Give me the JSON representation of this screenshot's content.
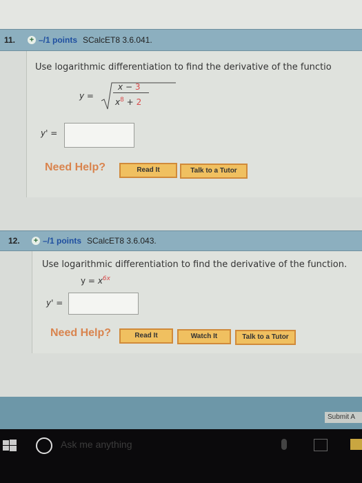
{
  "questions": [
    {
      "number": "11.",
      "points": "–/1 points",
      "code": "SCalcET8 3.6.041.",
      "prompt": "Use logarithmic differentiation to find the derivative of the functio",
      "function": {
        "lhs": "y =",
        "numerator_var": "x",
        "numerator_op": "−",
        "numerator_const": "3",
        "denominator_var": "x",
        "denominator_exp": "8",
        "denominator_op": "+",
        "denominator_const": "2"
      },
      "answer_label": "y' =",
      "answer_value": "",
      "need_help": "Need Help?",
      "buttons": [
        "Read It",
        "Talk to a Tutor"
      ]
    },
    {
      "number": "12.",
      "points": "–/1 points",
      "code": "SCalcET8 3.6.043.",
      "prompt": "Use logarithmic differentiation to find the derivative of the function.",
      "function": {
        "lhs": "y =",
        "base": "x",
        "exponent": "6x"
      },
      "answer_label": "y' =",
      "answer_value": "",
      "need_help": "Need Help?",
      "buttons": [
        "Read It",
        "Watch It",
        "Talk to a Tutor"
      ]
    }
  ],
  "submit_label": "Submit A",
  "taskbar": {
    "search_placeholder": "Ask me anything"
  },
  "colors": {
    "header": "#8cafbf",
    "points": "#1f4fa0",
    "need_help": "#d9844e",
    "button": "#f0c060",
    "taskbar": "#0b0a0c"
  }
}
